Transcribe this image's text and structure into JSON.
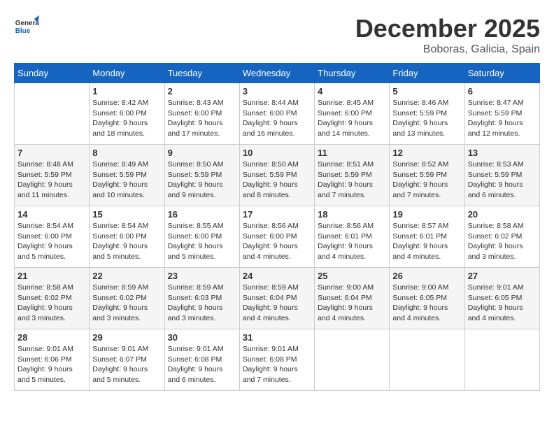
{
  "header": {
    "logo_general": "General",
    "logo_blue": "Blue",
    "month_title": "December 2025",
    "location": "Boboras, Galicia, Spain"
  },
  "weekdays": [
    "Sunday",
    "Monday",
    "Tuesday",
    "Wednesday",
    "Thursday",
    "Friday",
    "Saturday"
  ],
  "weeks": [
    [
      {
        "day": "",
        "sunrise": "",
        "sunset": "",
        "daylight": ""
      },
      {
        "day": "1",
        "sunrise": "Sunrise: 8:42 AM",
        "sunset": "Sunset: 6:00 PM",
        "daylight": "Daylight: 9 hours and 18 minutes."
      },
      {
        "day": "2",
        "sunrise": "Sunrise: 8:43 AM",
        "sunset": "Sunset: 6:00 PM",
        "daylight": "Daylight: 9 hours and 17 minutes."
      },
      {
        "day": "3",
        "sunrise": "Sunrise: 8:44 AM",
        "sunset": "Sunset: 6:00 PM",
        "daylight": "Daylight: 9 hours and 16 minutes."
      },
      {
        "day": "4",
        "sunrise": "Sunrise: 8:45 AM",
        "sunset": "Sunset: 6:00 PM",
        "daylight": "Daylight: 9 hours and 14 minutes."
      },
      {
        "day": "5",
        "sunrise": "Sunrise: 8:46 AM",
        "sunset": "Sunset: 5:59 PM",
        "daylight": "Daylight: 9 hours and 13 minutes."
      },
      {
        "day": "6",
        "sunrise": "Sunrise: 8:47 AM",
        "sunset": "Sunset: 5:59 PM",
        "daylight": "Daylight: 9 hours and 12 minutes."
      }
    ],
    [
      {
        "day": "7",
        "sunrise": "Sunrise: 8:48 AM",
        "sunset": "Sunset: 5:59 PM",
        "daylight": "Daylight: 9 hours and 11 minutes."
      },
      {
        "day": "8",
        "sunrise": "Sunrise: 8:49 AM",
        "sunset": "Sunset: 5:59 PM",
        "daylight": "Daylight: 9 hours and 10 minutes."
      },
      {
        "day": "9",
        "sunrise": "Sunrise: 8:50 AM",
        "sunset": "Sunset: 5:59 PM",
        "daylight": "Daylight: 9 hours and 9 minutes."
      },
      {
        "day": "10",
        "sunrise": "Sunrise: 8:50 AM",
        "sunset": "Sunset: 5:59 PM",
        "daylight": "Daylight: 9 hours and 8 minutes."
      },
      {
        "day": "11",
        "sunrise": "Sunrise: 8:51 AM",
        "sunset": "Sunset: 5:59 PM",
        "daylight": "Daylight: 9 hours and 7 minutes."
      },
      {
        "day": "12",
        "sunrise": "Sunrise: 8:52 AM",
        "sunset": "Sunset: 5:59 PM",
        "daylight": "Daylight: 9 hours and 7 minutes."
      },
      {
        "day": "13",
        "sunrise": "Sunrise: 8:53 AM",
        "sunset": "Sunset: 5:59 PM",
        "daylight": "Daylight: 9 hours and 6 minutes."
      }
    ],
    [
      {
        "day": "14",
        "sunrise": "Sunrise: 8:54 AM",
        "sunset": "Sunset: 6:00 PM",
        "daylight": "Daylight: 9 hours and 5 minutes."
      },
      {
        "day": "15",
        "sunrise": "Sunrise: 8:54 AM",
        "sunset": "Sunset: 6:00 PM",
        "daylight": "Daylight: 9 hours and 5 minutes."
      },
      {
        "day": "16",
        "sunrise": "Sunrise: 8:55 AM",
        "sunset": "Sunset: 6:00 PM",
        "daylight": "Daylight: 9 hours and 5 minutes."
      },
      {
        "day": "17",
        "sunrise": "Sunrise: 8:56 AM",
        "sunset": "Sunset: 6:00 PM",
        "daylight": "Daylight: 9 hours and 4 minutes."
      },
      {
        "day": "18",
        "sunrise": "Sunrise: 8:56 AM",
        "sunset": "Sunset: 6:01 PM",
        "daylight": "Daylight: 9 hours and 4 minutes."
      },
      {
        "day": "19",
        "sunrise": "Sunrise: 8:57 AM",
        "sunset": "Sunset: 6:01 PM",
        "daylight": "Daylight: 9 hours and 4 minutes."
      },
      {
        "day": "20",
        "sunrise": "Sunrise: 8:58 AM",
        "sunset": "Sunset: 6:02 PM",
        "daylight": "Daylight: 9 hours and 3 minutes."
      }
    ],
    [
      {
        "day": "21",
        "sunrise": "Sunrise: 8:58 AM",
        "sunset": "Sunset: 6:02 PM",
        "daylight": "Daylight: 9 hours and 3 minutes."
      },
      {
        "day": "22",
        "sunrise": "Sunrise: 8:59 AM",
        "sunset": "Sunset: 6:02 PM",
        "daylight": "Daylight: 9 hours and 3 minutes."
      },
      {
        "day": "23",
        "sunrise": "Sunrise: 8:59 AM",
        "sunset": "Sunset: 6:03 PM",
        "daylight": "Daylight: 9 hours and 3 minutes."
      },
      {
        "day": "24",
        "sunrise": "Sunrise: 8:59 AM",
        "sunset": "Sunset: 6:04 PM",
        "daylight": "Daylight: 9 hours and 4 minutes."
      },
      {
        "day": "25",
        "sunrise": "Sunrise: 9:00 AM",
        "sunset": "Sunset: 6:04 PM",
        "daylight": "Daylight: 9 hours and 4 minutes."
      },
      {
        "day": "26",
        "sunrise": "Sunrise: 9:00 AM",
        "sunset": "Sunset: 6:05 PM",
        "daylight": "Daylight: 9 hours and 4 minutes."
      },
      {
        "day": "27",
        "sunrise": "Sunrise: 9:01 AM",
        "sunset": "Sunset: 6:05 PM",
        "daylight": "Daylight: 9 hours and 4 minutes."
      }
    ],
    [
      {
        "day": "28",
        "sunrise": "Sunrise: 9:01 AM",
        "sunset": "Sunset: 6:06 PM",
        "daylight": "Daylight: 9 hours and 5 minutes."
      },
      {
        "day": "29",
        "sunrise": "Sunrise: 9:01 AM",
        "sunset": "Sunset: 6:07 PM",
        "daylight": "Daylight: 9 hours and 5 minutes."
      },
      {
        "day": "30",
        "sunrise": "Sunrise: 9:01 AM",
        "sunset": "Sunset: 6:08 PM",
        "daylight": "Daylight: 9 hours and 6 minutes."
      },
      {
        "day": "31",
        "sunrise": "Sunrise: 9:01 AM",
        "sunset": "Sunset: 6:08 PM",
        "daylight": "Daylight: 9 hours and 7 minutes."
      },
      {
        "day": "",
        "sunrise": "",
        "sunset": "",
        "daylight": ""
      },
      {
        "day": "",
        "sunrise": "",
        "sunset": "",
        "daylight": ""
      },
      {
        "day": "",
        "sunrise": "",
        "sunset": "",
        "daylight": ""
      }
    ]
  ]
}
